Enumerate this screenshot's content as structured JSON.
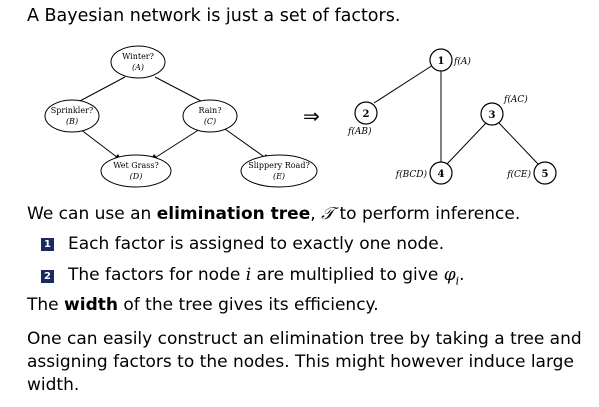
{
  "title": "A Bayesian network is just a set of factors.",
  "bn": {
    "nodes": [
      {
        "id": "A",
        "label": "Winter?",
        "var": "(A)"
      },
      {
        "id": "B",
        "label": "Sprinkler?",
        "var": "(B)"
      },
      {
        "id": "C",
        "label": "Rain?",
        "var": "(C)"
      },
      {
        "id": "D",
        "label": "Wet Grass?",
        "var": "(D)"
      },
      {
        "id": "E",
        "label": "Slippery Road?",
        "var": "(E)"
      }
    ]
  },
  "arrow": "⇒",
  "tree": {
    "nodes": [
      {
        "num": "1",
        "factor": "f(A)"
      },
      {
        "num": "2",
        "factor": "f(AB)"
      },
      {
        "num": "3",
        "factor": "f(AC)"
      },
      {
        "num": "4",
        "factor": "f(BCD)"
      },
      {
        "num": "5",
        "factor": "f(CE)"
      }
    ]
  },
  "intro": {
    "pre": "We can use an ",
    "bold": "elimination tree",
    "mid": ", ",
    "symbol": "𝒯",
    "post": " to perform inference."
  },
  "bullets": [
    {
      "num": "1",
      "text": "Each factor is assigned to exactly one node."
    },
    {
      "num": "2",
      "pre": "The factors for node ",
      "var": "i",
      "mid": " are multiplied to give ",
      "phi": "φ",
      "sub": "i",
      "post": "."
    }
  ],
  "width_line": {
    "pre": "The ",
    "bold": "width",
    "post": " of the tree gives its efficiency."
  },
  "paragraph": "One can easily construct an elimination tree by taking a tree and assigning factors to the nodes. This might however induce large width."
}
